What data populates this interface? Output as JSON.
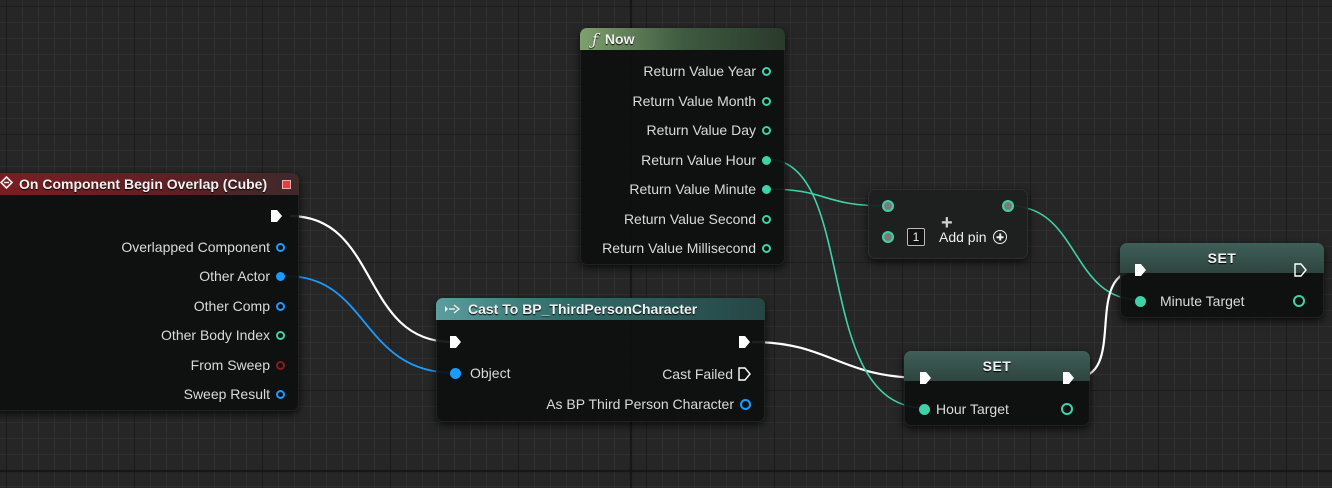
{
  "colors": {
    "exec": "#ffffff",
    "object_blue": "#1a9cff",
    "int_teal": "#3fd1a8",
    "bool_red": "#8a1c1c",
    "overlap_header": "#7a1e22",
    "pure_header": "#7fa06e",
    "cast_header": "#2f6b68",
    "set_header": "#3f5f58"
  },
  "overlap_node": {
    "title": "On Component Begin Overlap (Cube)",
    "title_icon": "event-diamond-icon",
    "close_icon": "red-square-icon",
    "pins": [
      "Overlapped Component",
      "Other Actor",
      "Other Comp",
      "Other Body Index",
      "From Sweep",
      "Sweep Result"
    ]
  },
  "now_node": {
    "title": "Now",
    "title_icon": "function-f-icon",
    "pins": [
      "Return Value Year",
      "Return Value Month",
      "Return Value Day",
      "Return Value Hour",
      "Return Value Minute",
      "Return Value Second",
      "Return Value Millisecond"
    ]
  },
  "add_node": {
    "operator": "+",
    "default_value": "1",
    "add_pin_label": "Add pin",
    "add_pin_icon": "plus-circle-icon"
  },
  "cast_node": {
    "title": "Cast To BP_ThirdPersonCharacter",
    "title_icon": "cast-arrows-icon",
    "object_label": "Object",
    "cast_failed_label": "Cast Failed",
    "as_label": "As BP Third Person Character"
  },
  "set_hour_node": {
    "title": "SET",
    "var_label": "Hour Target"
  },
  "set_minute_node": {
    "title": "SET",
    "var_label": "Minute Target"
  }
}
